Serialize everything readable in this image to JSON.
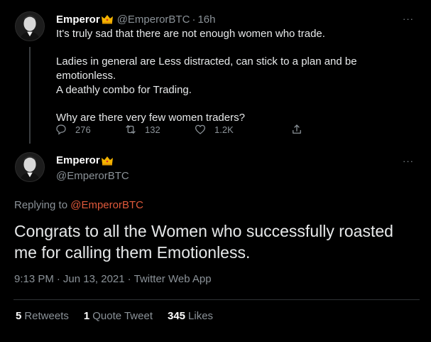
{
  "parent_tweet": {
    "author_name": "Emperor",
    "author_handle": "@EmperorBTC",
    "separator": "·",
    "time": "16h",
    "lines": [
      "It's truly sad that there are not enough women who trade.",
      "Ladies in general are Less distracted, can stick to a plan and be emotionless.",
      "A deathly combo for Trading.",
      "Why are there very few women traders?"
    ],
    "reply_count": "276",
    "retweet_count": "132",
    "like_count": "1.2K"
  },
  "main_tweet": {
    "author_name": "Emperor",
    "author_handle": "@EmperorBTC",
    "replying_prefix": "Replying to",
    "replying_to": "@EmperorBTC",
    "text": "Congrats to all the Women who successfully roasted me for calling them Emotionless.",
    "time": "9:13 PM",
    "date": "Jun 13, 2021",
    "source": "Twitter Web App",
    "separator": "·",
    "retweets": "5",
    "retweets_label": "Retweets",
    "quotes": "1",
    "quotes_label": "Quote Tweet",
    "likes": "345",
    "likes_label": "Likes"
  },
  "more_glyph": "···",
  "colors": {
    "background": "#000000",
    "text": "#e7e9ea",
    "muted": "#8b9298",
    "mention": "#e0593b",
    "divider": "#2f3336",
    "crown": "#f4b400"
  },
  "icons": [
    "reply-icon",
    "retweet-icon",
    "like-icon",
    "share-icon",
    "crown-icon",
    "more-icon"
  ]
}
